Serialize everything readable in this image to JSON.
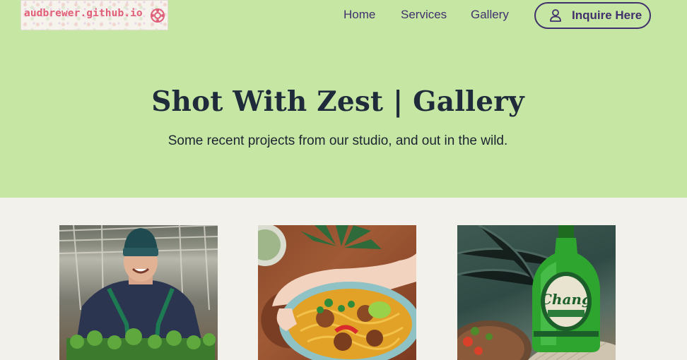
{
  "site": {
    "logo_text": "audbrewer.github.io"
  },
  "nav": {
    "links": [
      "Home",
      "Services",
      "Gallery"
    ],
    "cta_label": "Inquire Here"
  },
  "hero": {
    "title": "Shot With Zest | Gallery",
    "subtitle": "Some recent projects from our studio, and out in the wild."
  },
  "gallery": {
    "photos": [
      {
        "subject": "farmer holding tray of greens in greenhouse"
      },
      {
        "subject": "hand holding bowl of noodle curry with meatballs and chili"
      },
      {
        "subject": "green Chang beer bottle next to plate of food",
        "label_text": "Chang"
      }
    ]
  },
  "colors": {
    "hero_bg": "#c6e6a4",
    "page_bg": "#f3f1ec",
    "accent": "#40306c",
    "title": "#1f2b3a"
  }
}
